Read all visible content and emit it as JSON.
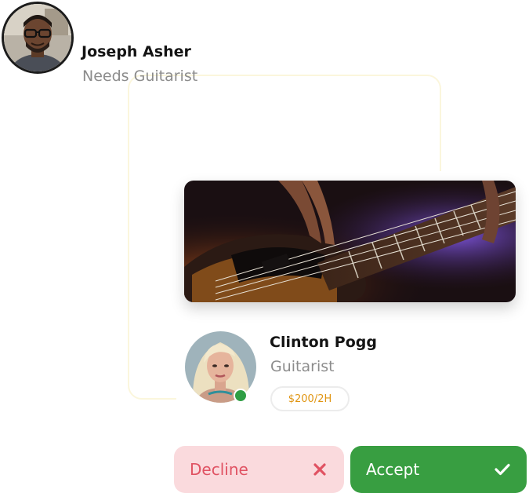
{
  "requester": {
    "name": "Joseph Asher",
    "subtitle": "Needs Guitarist",
    "avatar_icon": "person-avatar"
  },
  "musician": {
    "name": "Clinton Pogg",
    "role": "Guitarist",
    "price": "$200/2H",
    "status": "online",
    "status_color": "#2f9e44",
    "cover_image": "bass-guitar-photo"
  },
  "actions": {
    "decline_label": "Decline",
    "decline_icon": "close-icon",
    "accept_label": "Accept",
    "accept_icon": "check-icon"
  },
  "colors": {
    "accept_bg": "#389e41",
    "decline_bg": "#fadadd",
    "decline_text": "#e05262",
    "price_text": "#e09512"
  }
}
